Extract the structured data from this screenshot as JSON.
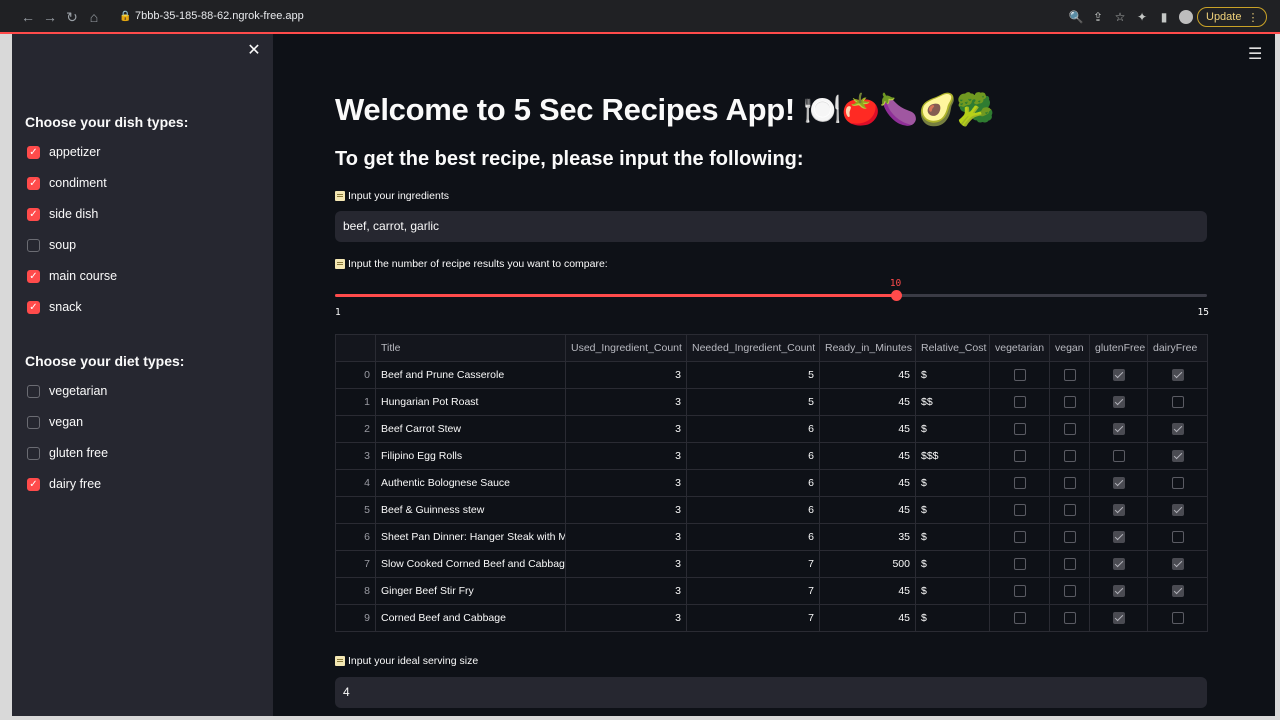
{
  "browser": {
    "url": "7bbb-35-185-88-62.ngrok-free.app",
    "update_label": "Update"
  },
  "sidebar": {
    "dish_heading": "Choose your dish types:",
    "dish_types": [
      {
        "label": "appetizer",
        "checked": true
      },
      {
        "label": "condiment",
        "checked": true
      },
      {
        "label": "side dish",
        "checked": true
      },
      {
        "label": "soup",
        "checked": false
      },
      {
        "label": "main course",
        "checked": true
      },
      {
        "label": "snack",
        "checked": true
      }
    ],
    "diet_heading": "Choose your diet types:",
    "diet_types": [
      {
        "label": "vegetarian",
        "checked": false
      },
      {
        "label": "vegan",
        "checked": false
      },
      {
        "label": "gluten free",
        "checked": false
      },
      {
        "label": "dairy free",
        "checked": true
      }
    ]
  },
  "main": {
    "title": "Welcome to 5 Sec Recipes App! 🍽️🍅🍆🥑🥦",
    "subtitle": "To get the best recipe, please input the following:",
    "ingredients_label": "Input your ingredients",
    "ingredients_value": "beef, carrot, garlic",
    "count_label": "Input the number of recipe results you want to compare:",
    "slider": {
      "min": "1",
      "max": "15",
      "value": "10"
    },
    "serving_label": "Input your ideal serving size",
    "serving_value": "4"
  },
  "table": {
    "columns": [
      "",
      "Title",
      "Used_Ingredient_Count",
      "Needed_Ingredient_Count",
      "Ready_in_Minutes",
      "Relative_Cost",
      "vegetarian",
      "vegan",
      "glutenFree",
      "dairyFree"
    ],
    "rows": [
      {
        "idx": "0",
        "title": "Beef and Prune Casserole",
        "used": "3",
        "needed": "5",
        "ready": "45",
        "cost": "$",
        "vegetarian": false,
        "vegan": false,
        "glutenFree": true,
        "dairyFree": true
      },
      {
        "idx": "1",
        "title": "Hungarian Pot Roast",
        "used": "3",
        "needed": "5",
        "ready": "45",
        "cost": "$$",
        "vegetarian": false,
        "vegan": false,
        "glutenFree": true,
        "dairyFree": false
      },
      {
        "idx": "2",
        "title": "Beef Carrot Stew",
        "used": "3",
        "needed": "6",
        "ready": "45",
        "cost": "$",
        "vegetarian": false,
        "vegan": false,
        "glutenFree": true,
        "dairyFree": true
      },
      {
        "idx": "3",
        "title": "Filipino Egg Rolls",
        "used": "3",
        "needed": "6",
        "ready": "45",
        "cost": "$$$",
        "vegetarian": false,
        "vegan": false,
        "glutenFree": false,
        "dairyFree": true
      },
      {
        "idx": "4",
        "title": "Authentic Bolognese Sauce",
        "used": "3",
        "needed": "6",
        "ready": "45",
        "cost": "$",
        "vegetarian": false,
        "vegan": false,
        "glutenFree": true,
        "dairyFree": false
      },
      {
        "idx": "5",
        "title": "Beef & Guinness stew",
        "used": "3",
        "needed": "6",
        "ready": "45",
        "cost": "$",
        "vegetarian": false,
        "vegan": false,
        "glutenFree": true,
        "dairyFree": true
      },
      {
        "idx": "6",
        "title": "Sheet Pan Dinner: Hanger Steak with Mus",
        "used": "3",
        "needed": "6",
        "ready": "35",
        "cost": "$",
        "vegetarian": false,
        "vegan": false,
        "glutenFree": true,
        "dairyFree": false
      },
      {
        "idx": "7",
        "title": "Slow Cooked Corned Beef and Cabbage",
        "used": "3",
        "needed": "7",
        "ready": "500",
        "cost": "$",
        "vegetarian": false,
        "vegan": false,
        "glutenFree": true,
        "dairyFree": true
      },
      {
        "idx": "8",
        "title": "Ginger Beef Stir Fry",
        "used": "3",
        "needed": "7",
        "ready": "45",
        "cost": "$",
        "vegetarian": false,
        "vegan": false,
        "glutenFree": true,
        "dairyFree": true
      },
      {
        "idx": "9",
        "title": "Corned Beef and Cabbage",
        "used": "3",
        "needed": "7",
        "ready": "45",
        "cost": "$",
        "vegetarian": false,
        "vegan": false,
        "glutenFree": true,
        "dairyFree": false
      }
    ]
  }
}
